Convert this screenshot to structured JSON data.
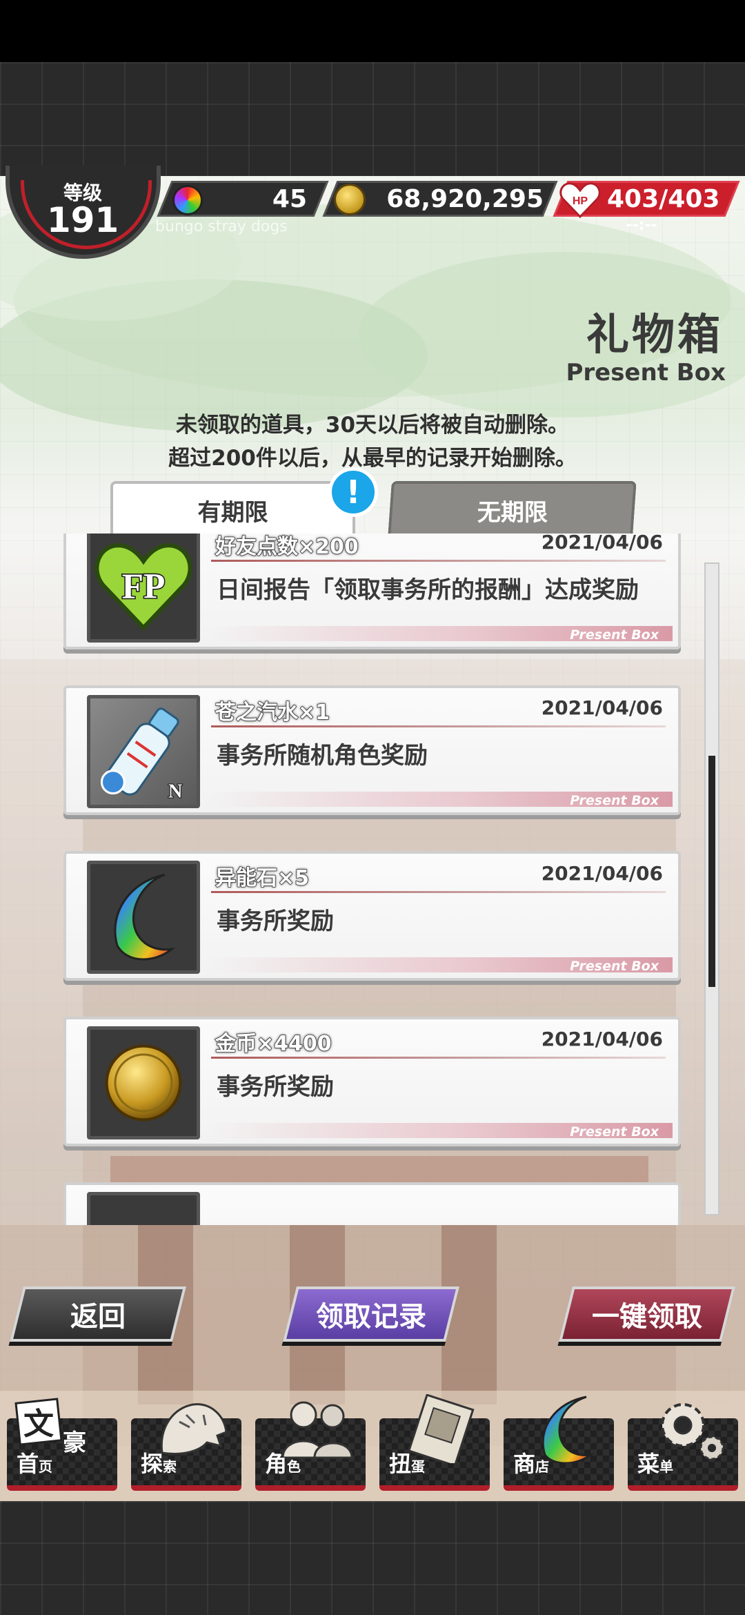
{
  "status": {
    "level_label": "等级",
    "level_value": "191",
    "gems": "45",
    "coins": "68,920,295",
    "hp": "403/403",
    "hp_timer": "--:--",
    "game_name": "bungo stray dogs"
  },
  "header": {
    "title": "礼物箱",
    "subtitle": "Present Box",
    "notice_line1": "未领取的道具，30天以后将被自动删除。",
    "notice_line2": "超过200件以后，从最早的记录开始删除。"
  },
  "tabs": [
    {
      "label": "有期限",
      "active": true
    },
    {
      "label": "无期限",
      "active": false
    }
  ],
  "alert_badge": "!",
  "presents": [
    {
      "name": "好友点数×200",
      "date": "2021/04/06",
      "desc": "日间报告「领取事务所的报酬」达成奖励",
      "footer": "Present Box",
      "icon": "fp-heart-icon"
    },
    {
      "name": "苍之汽水×1",
      "date": "2021/04/06",
      "desc": "事务所随机角色奖励",
      "footer": "Present Box",
      "icon": "soda-bottle-icon"
    },
    {
      "name": "异能石×5",
      "date": "2021/04/06",
      "desc": "事务所奖励",
      "footer": "Present Box",
      "icon": "crescent-stone-icon"
    },
    {
      "name": "金币×4400",
      "date": "2021/04/06",
      "desc": "事务所奖励",
      "footer": "Present Box",
      "icon": "gold-coin-icon"
    }
  ],
  "item_badge_n": "N",
  "fp_text": "FP",
  "actions": {
    "back": "返回",
    "history": "领取记录",
    "claim_all": "一键领取"
  },
  "nav": [
    {
      "label": "首",
      "sub": "页",
      "icon": "bungo-logo-icon",
      "logo_text1": "文",
      "logo_text2": "豪"
    },
    {
      "label": "探",
      "sub": "索",
      "icon": "tiger-icon"
    },
    {
      "label": "角",
      "sub": "色",
      "icon": "people-icon"
    },
    {
      "label": "扭",
      "sub": "蛋",
      "icon": "book-icon"
    },
    {
      "label": "商",
      "sub": "店",
      "icon": "crescent-stone-icon"
    },
    {
      "label": "菜",
      "sub": "单",
      "icon": "gear-icon"
    }
  ],
  "colors": {
    "accent_red": "#cc1f2c",
    "history_purple": "#6a4bb8",
    "claim_red": "#8c2b3d",
    "badge_blue": "#1aa6e8"
  }
}
